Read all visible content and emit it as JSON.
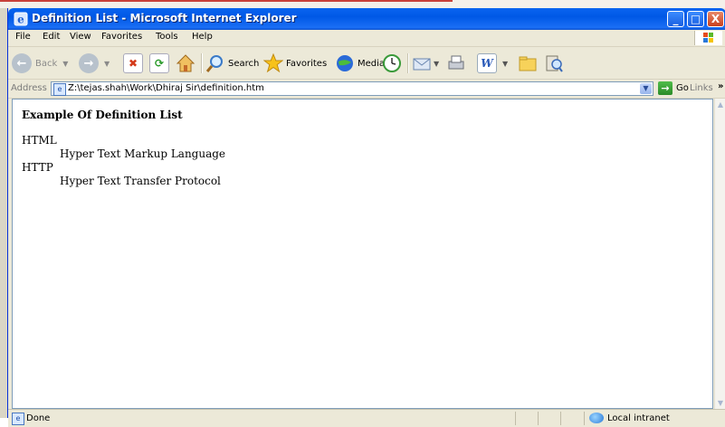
{
  "window": {
    "title": "Definition List - Microsoft Internet Explorer",
    "controls": {
      "minimize": "_",
      "maximize": "□",
      "close": "X"
    }
  },
  "menubar": {
    "items": [
      "File",
      "Edit",
      "View",
      "Favorites",
      "Tools",
      "Help"
    ]
  },
  "toolbar": {
    "back_label": "Back",
    "search_label": "Search",
    "favorites_label": "Favorites",
    "media_label": "Media"
  },
  "addressbar": {
    "label": "Address",
    "value": "Z:\\tejas.shah\\Work\\Dhiraj Sir\\definition.htm",
    "go_label": "Go",
    "links_label": "Links",
    "links_more": "»"
  },
  "page": {
    "heading": "Example Of Definition List",
    "definitions": [
      {
        "term": "HTML",
        "description": "Hyper Text Markup Language"
      },
      {
        "term": "HTTP",
        "description": "Hyper Text Transfer Protocol"
      }
    ]
  },
  "statusbar": {
    "status": "Done",
    "zone": "Local intranet"
  },
  "colors": {
    "titlebar": "#0058e6",
    "chrome": "#ece9d8",
    "close_button": "#c8401e"
  }
}
